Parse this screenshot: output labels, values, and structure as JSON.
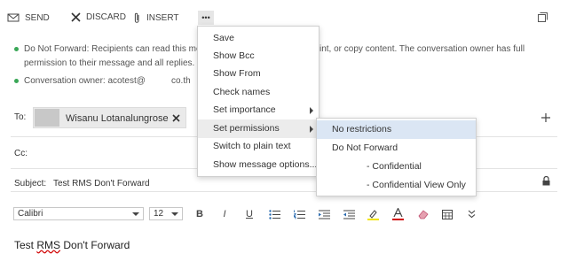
{
  "toolbar": {
    "send_label": "SEND",
    "discard_label": "DISCARD",
    "insert_label": "INSERT",
    "more_label": "•••",
    "icons": {
      "send": "send-icon",
      "discard": "close-icon",
      "insert": "paperclip-icon",
      "popout": "popout-icon"
    }
  },
  "info": {
    "policy_left": "Do Not Forward: Recipients can read this mes",
    "policy_right": "int, or copy content. The conversation owner has full",
    "policy_line2": "permission to their message and all replies.",
    "owner_left": "Conversation owner: acotest@",
    "owner_right": "co.th"
  },
  "fields": {
    "to_label": "To:",
    "cc_label": "Cc:",
    "subject_label": "Subject:",
    "subject_value": "Test RMS Don't Forward",
    "recipient_name": "Wisanu Lotanalungrose",
    "remove_icon": "close-icon",
    "add_icon": "plus-icon",
    "lock_icon": "lock-icon"
  },
  "menu": {
    "items": [
      {
        "label": "Save"
      },
      {
        "label": "Show Bcc"
      },
      {
        "label": "Show From"
      },
      {
        "label": "Check names"
      },
      {
        "label": "Set importance"
      },
      {
        "label": "Set permissions"
      },
      {
        "label": "Switch to plain text"
      },
      {
        "label": "Show message options..."
      }
    ]
  },
  "submenu": {
    "items": [
      {
        "label": "No restrictions"
      },
      {
        "label": "Do Not Forward"
      },
      {
        "label": "- Confidential"
      },
      {
        "label": "- Confidential View Only"
      }
    ]
  },
  "format": {
    "font": "Calibri",
    "size": "12",
    "bold": "B",
    "italic": "I",
    "underline": "U",
    "icons": [
      "bullets-icon",
      "numbering-icon",
      "indent-icon",
      "outdent-icon",
      "highlight-icon",
      "font-color-icon",
      "clear-format-icon",
      "table-icon",
      "more-icon"
    ],
    "highlight_color": "#f2e400",
    "font_color": "#d00000"
  },
  "body": {
    "text_prefix": "Test ",
    "text_misspelled": "RMS",
    "text_suffix": " Don't Forward"
  }
}
